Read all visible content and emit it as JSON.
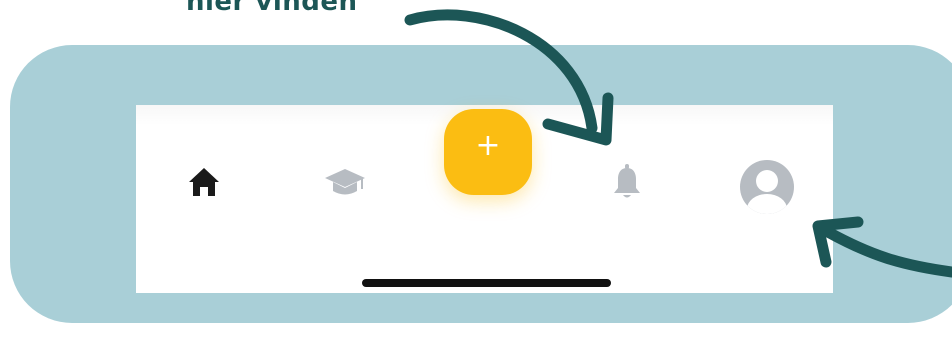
{
  "annotation": {
    "caption": "hier vinden"
  },
  "colors": {
    "teal_panel": "#a9cfd7",
    "arrow": "#1c5656",
    "fab": "#fbbd12",
    "active_icon": "#1a1a1a",
    "inactive_icon": "#b7bcc2"
  },
  "tab_bar": {
    "items": [
      {
        "icon": "home-icon",
        "active": true
      },
      {
        "icon": "graduation-cap-icon",
        "active": false
      },
      {
        "icon": "plus-icon",
        "primary": true,
        "label": "+"
      },
      {
        "icon": "bell-icon",
        "active": false
      },
      {
        "icon": "user-avatar-icon",
        "active": false
      }
    ]
  }
}
